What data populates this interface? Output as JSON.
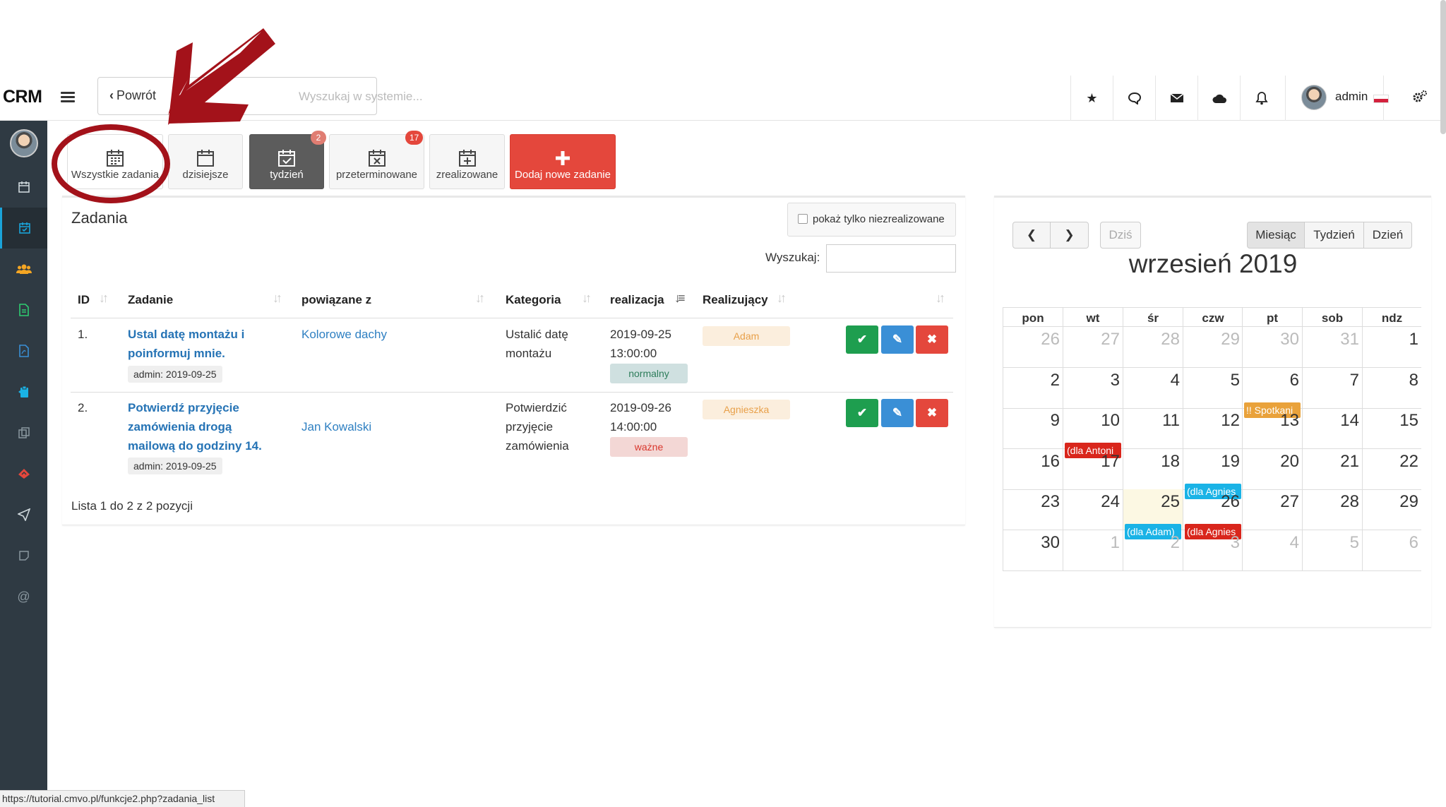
{
  "header": {
    "logo": "CRM",
    "back_label": "Powrót",
    "search_placeholder": "Wyszukaj w systemie...",
    "user_name": "admin"
  },
  "toolbar": {
    "buttons": [
      {
        "label": "Wszystkie zadania"
      },
      {
        "label": "dzisiejsze"
      },
      {
        "label": "tydzień",
        "badge": "2"
      },
      {
        "label": "przeterminowane",
        "badge": "17"
      },
      {
        "label": "zrealizowane"
      },
      {
        "label": "Dodaj nowe zadanie"
      }
    ]
  },
  "tasks": {
    "title": "Zadania",
    "only_unfinished_label": "pokaż tylko niezrealizowane",
    "search_label": "Wyszukaj:",
    "columns": [
      "ID",
      "Zadanie",
      "powiązane z",
      "Kategoria",
      "realizacja",
      "Realizujący"
    ],
    "rows": [
      {
        "id": "1.",
        "task_line1": "Ustal datę montażu i",
        "task_line2": "poinformuj mnie.",
        "author": "admin: 2019-09-25",
        "related": "Kolorowe dachy",
        "category_line1": "Ustalić datę",
        "category_line2": "montażu",
        "date": "2019-09-25",
        "time": "13:00:00",
        "priority": "normalny",
        "assignee": "Adam"
      },
      {
        "id": "2.",
        "task_line1": "Potwierdź przyjęcie",
        "task_line2": "zamówienia drogą",
        "task_line3": "mailową do godziny 14.",
        "author": "admin: 2019-09-25",
        "related": "Jan Kowalski",
        "category_line1": "Potwierdzić",
        "category_line2": "przyjęcie",
        "category_line3": "zamówienia",
        "date": "2019-09-26",
        "time": "14:00:00",
        "priority": "ważne",
        "assignee": "Agnieszka"
      }
    ],
    "footer": "Lista 1 do 2 z 2 pozycji"
  },
  "calendar": {
    "today_label": "Dziś",
    "views": [
      "Miesiąc",
      "Tydzień",
      "Dzień"
    ],
    "title": "wrzesień 2019",
    "weekdays": [
      "pon",
      "wt",
      "śr",
      "czw",
      "pt",
      "sob",
      "ndz"
    ],
    "weeks": [
      [
        {
          "d": "26",
          "o": true
        },
        {
          "d": "27",
          "o": true
        },
        {
          "d": "28",
          "o": true
        },
        {
          "d": "29",
          "o": true
        },
        {
          "d": "30",
          "o": true
        },
        {
          "d": "31",
          "o": true
        },
        {
          "d": "1"
        }
      ],
      [
        {
          "d": "2"
        },
        {
          "d": "3"
        },
        {
          "d": "4"
        },
        {
          "d": "5"
        },
        {
          "d": "6",
          "ev": "!! Spotkani",
          "c": "#e9a23b"
        },
        {
          "d": "7"
        },
        {
          "d": "8"
        }
      ],
      [
        {
          "d": "9"
        },
        {
          "d": "10",
          "ev": "(dla Antoni",
          "c": "#d9261c"
        },
        {
          "d": "11"
        },
        {
          "d": "12"
        },
        {
          "d": "13"
        },
        {
          "d": "14"
        },
        {
          "d": "15"
        }
      ],
      [
        {
          "d": "16"
        },
        {
          "d": "17"
        },
        {
          "d": "18"
        },
        {
          "d": "19",
          "ev": "(dla Agnies",
          "c": "#1ab3e6"
        },
        {
          "d": "20"
        },
        {
          "d": "21"
        },
        {
          "d": "22"
        }
      ],
      [
        {
          "d": "23"
        },
        {
          "d": "24"
        },
        {
          "d": "25",
          "ev": "(dla Adam)",
          "c": "#1ab3e6",
          "t": true
        },
        {
          "d": "26",
          "ev": "(dla Agnies",
          "c": "#d9261c"
        },
        {
          "d": "27"
        },
        {
          "d": "28"
        },
        {
          "d": "29"
        }
      ],
      [
        {
          "d": "30"
        },
        {
          "d": "1",
          "o": true
        },
        {
          "d": "2",
          "o": true
        },
        {
          "d": "3",
          "o": true
        },
        {
          "d": "4",
          "o": true
        },
        {
          "d": "5",
          "o": true
        },
        {
          "d": "6",
          "o": true
        }
      ]
    ]
  },
  "status_url": "https://tutorial.cmvo.pl/funkcje2.php?zadania_list",
  "colors": {
    "primary_link": "#2573b5",
    "sidebar_bg": "#2f3a43",
    "danger": "#e4473c",
    "success": "#1e9e4f",
    "info": "#3a8fd6",
    "annotation": "#a3121a"
  }
}
